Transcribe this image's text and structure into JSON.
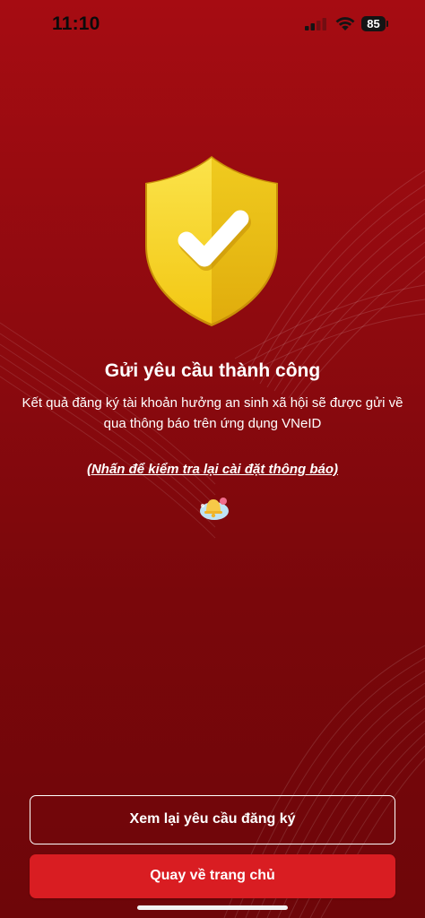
{
  "status_bar": {
    "time": "11:10",
    "battery_level": "85",
    "icons": [
      "signal-icon",
      "wifi-icon",
      "battery-icon"
    ]
  },
  "success": {
    "icon": "shield-check-icon",
    "title": "Gửi yêu cầu thành công",
    "description": "Kết quả đăng ký tài khoản hưởng an sinh xã hội sẽ được gửi về qua thông báo trên ứng dụng VNeID",
    "settings_link": "(Nhấn để kiểm tra lại cài đặt thông báo)",
    "bell_icon": "notification-bell-icon"
  },
  "actions": {
    "review_label": "Xem lại yêu cầu đăng ký",
    "home_label": "Quay về trang chủ"
  },
  "colors": {
    "background": "#9a0b10",
    "primary_button": "#d91d22",
    "shield": "#f5d41f"
  }
}
